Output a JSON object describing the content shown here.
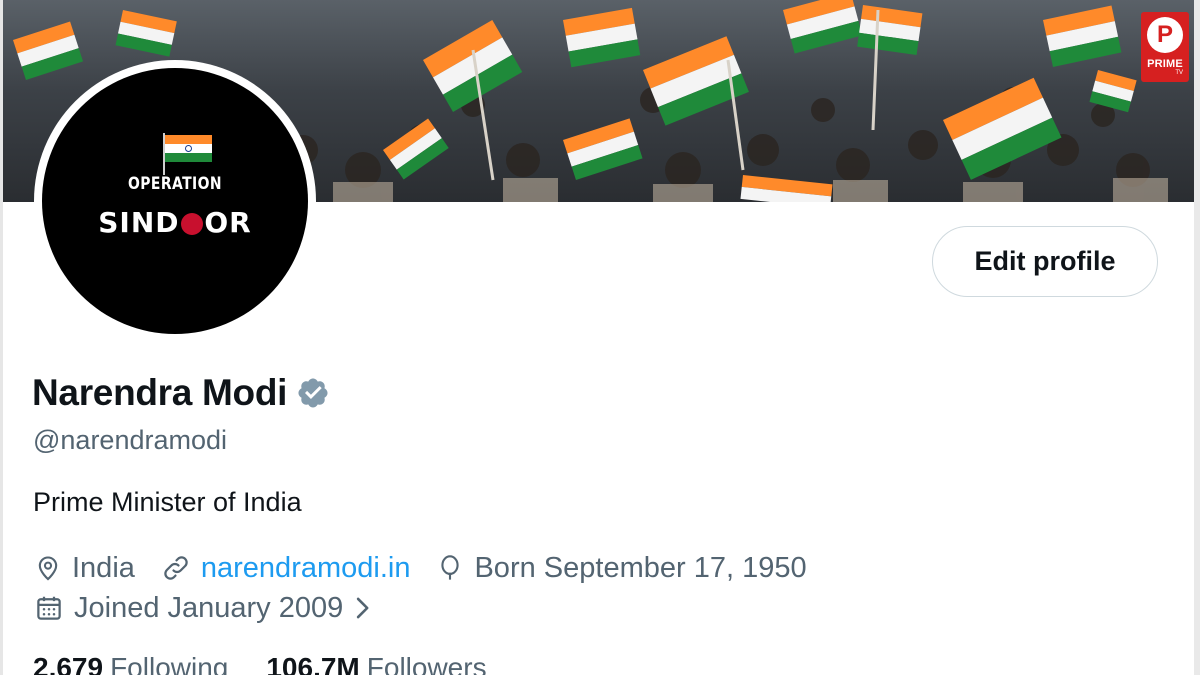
{
  "profile": {
    "display_name": "Narendra Modi",
    "handle": "@narendramodi",
    "bio": "Prime Minister of India",
    "location": "India",
    "website": "narendramodi.in",
    "birthday": "Born September 17, 1950",
    "joined": "Joined January 2009",
    "verified": true,
    "following_count": "2,679",
    "following_label": "Following",
    "followers_count": "106.7M",
    "followers_label": "Followers"
  },
  "avatar": {
    "line1": "OPERATION",
    "line2_left": "SIND",
    "line2_o": "O",
    "line2_right": "OR"
  },
  "actions": {
    "edit_profile_label": "Edit profile"
  },
  "watermark": {
    "letter": "P",
    "label": "PRIME",
    "sub": "TV"
  },
  "colors": {
    "link": "#1d9bf0",
    "secondary_text": "#536471",
    "primary_text": "#0f1419",
    "verified_badge": "#829aab",
    "sindoor_red": "#c8102e"
  },
  "icons": {
    "location": "location-pin-icon",
    "website": "link-icon",
    "birthday": "balloon-icon",
    "joined": "calendar-icon",
    "verified": "verified-badge-icon"
  }
}
